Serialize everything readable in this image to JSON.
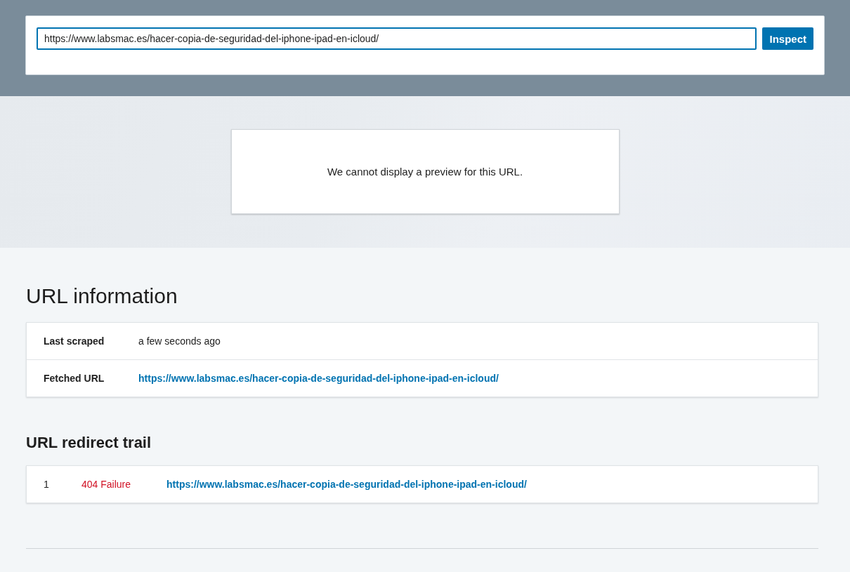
{
  "inspector": {
    "url_value": "https://www.labsmac.es/hacer-copia-de-seguridad-del-iphone-ipad-en-icloud/",
    "button": "Inspect"
  },
  "preview": {
    "message": "We cannot display a preview for this URL."
  },
  "url_information": {
    "title": "URL information",
    "rows": [
      {
        "label": "Last scraped",
        "value": "a few seconds ago",
        "kind": "text"
      },
      {
        "label": "Fetched URL",
        "value": "https://www.labsmac.es/hacer-copia-de-seguridad-del-iphone-ipad-en-icloud/",
        "kind": "link"
      }
    ]
  },
  "redirect_trail": {
    "title": "URL redirect trail",
    "rows": [
      {
        "index": "1",
        "status": "404 Failure",
        "color": "#d11124",
        "url": "https://www.labsmac.es/hacer-copia-de-seguridad-del-iphone-ipad-en-icloud/"
      }
    ]
  }
}
